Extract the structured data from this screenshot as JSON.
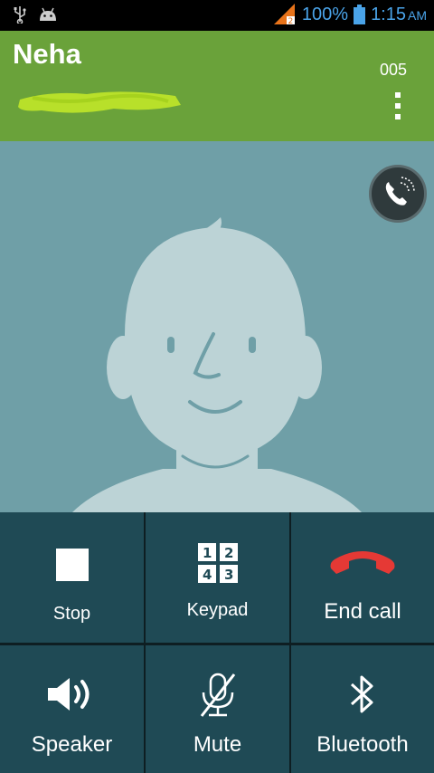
{
  "status_bar": {
    "battery_percent": "100%",
    "time": "1:15",
    "ampm": "AM",
    "icons": [
      "usb-icon",
      "android-icon",
      "signal-icon",
      "battery-icon"
    ],
    "signal_color": "#e8731a",
    "icon_color": "#4aa3e8"
  },
  "header": {
    "caller_name": "Neha",
    "duration": "005",
    "background_color": "#6aa23a",
    "redaction_color": "#b8e02a"
  },
  "photo": {
    "background_color": "#6f9fa7",
    "avatar_color": "#bcd3d6"
  },
  "controls": {
    "stop_label": "Stop",
    "keypad_label": "Keypad",
    "keypad_digits": [
      "1",
      "2",
      "4",
      "3"
    ],
    "end_call_label": "End call",
    "speaker_label": "Speaker",
    "mute_label": "Mute",
    "bluetooth_label": "Bluetooth",
    "end_call_color": "#e53935",
    "tile_color": "#1f4a55"
  }
}
